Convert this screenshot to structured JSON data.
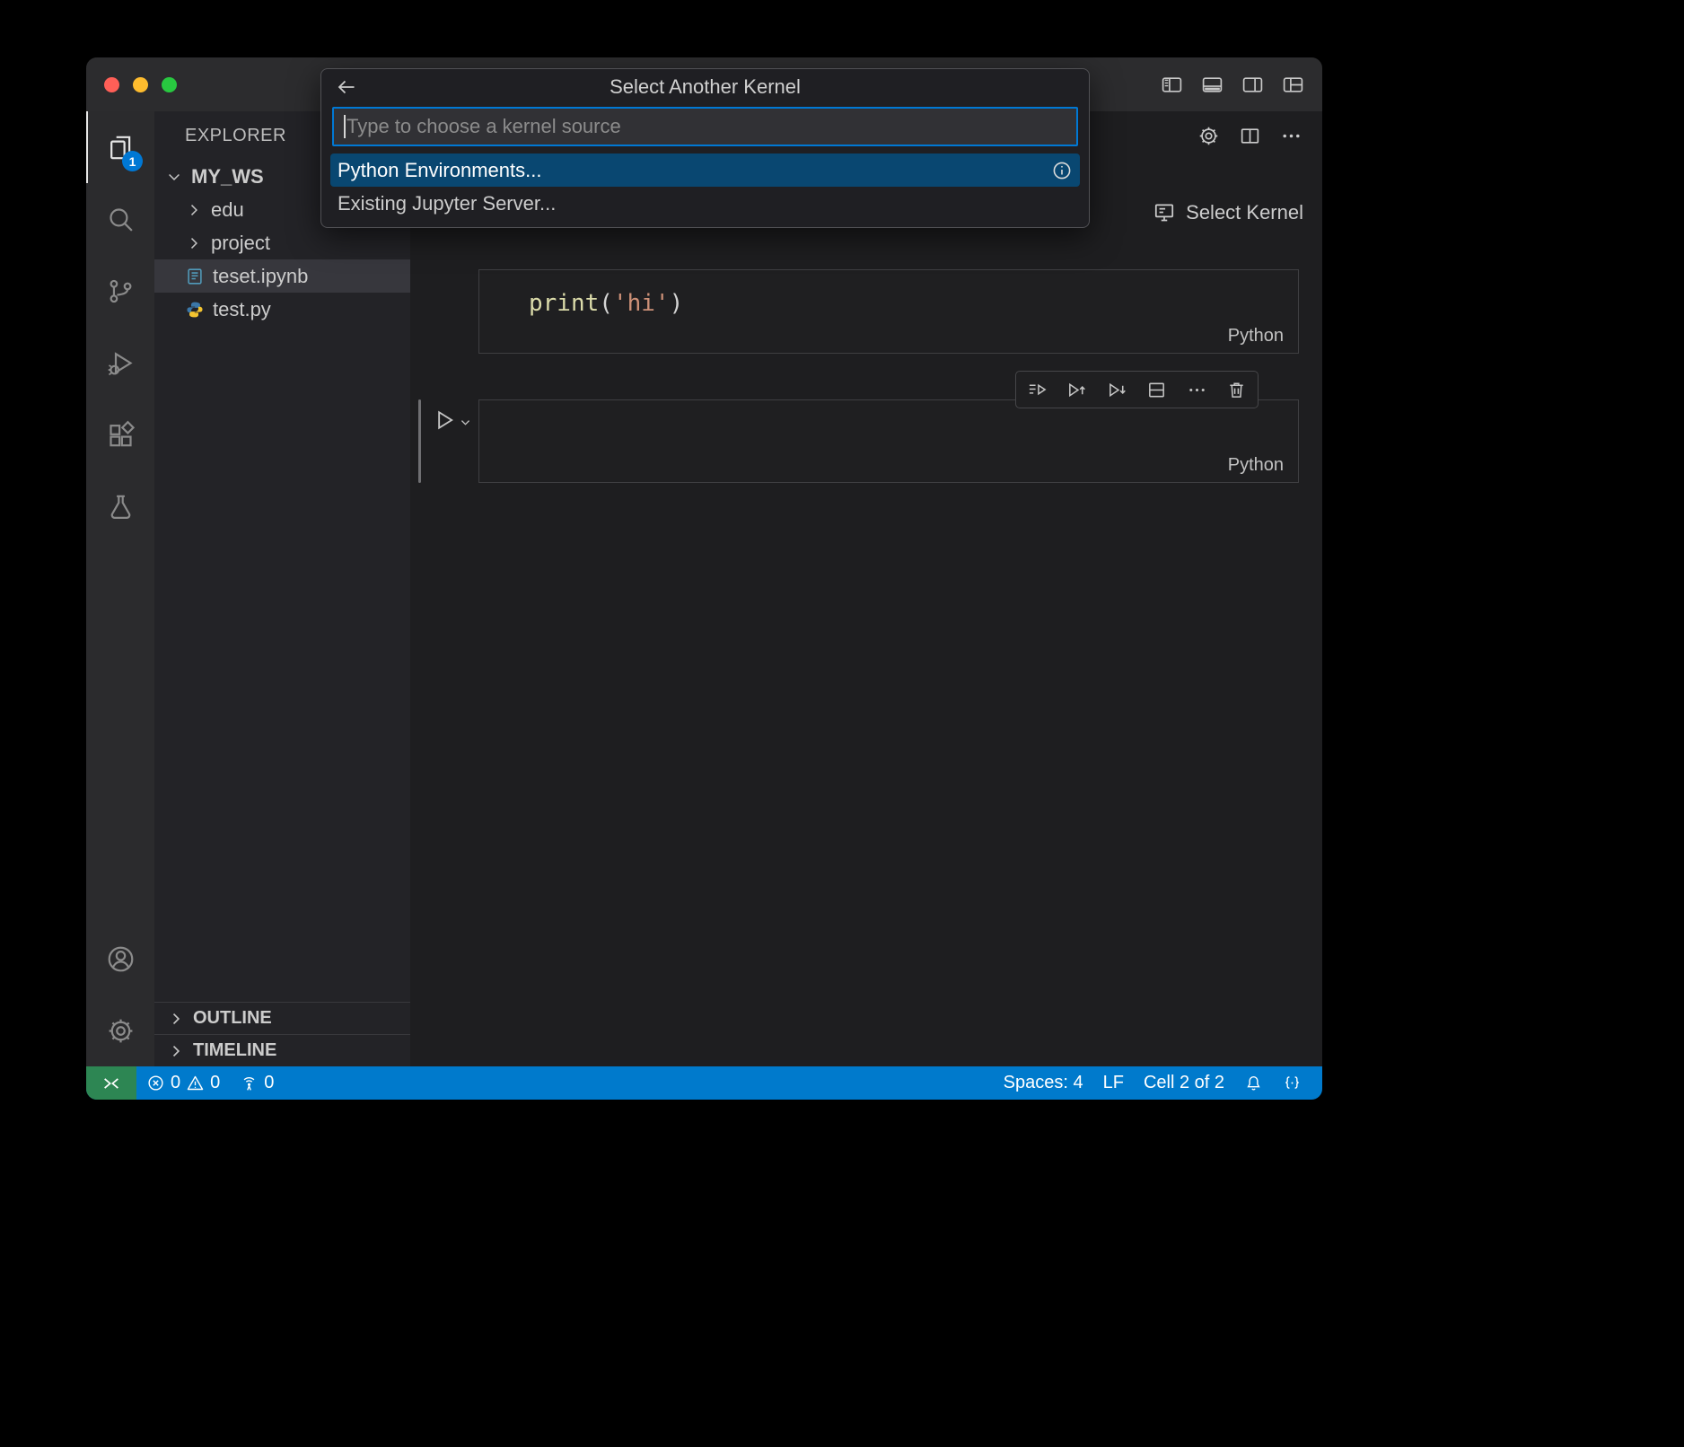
{
  "quick_pick": {
    "title": "Select Another Kernel",
    "input_placeholder": "Type to choose a kernel source",
    "items": [
      {
        "label": "Python Environments..."
      },
      {
        "label": "Existing Jupyter Server..."
      }
    ]
  },
  "activity_bar": {
    "explorer_badge": "1"
  },
  "sidebar": {
    "title": "EXPLORER",
    "workspace_label": "MY_WS",
    "items": [
      {
        "label": "edu"
      },
      {
        "label": "project"
      },
      {
        "label": "teset.ipynb"
      },
      {
        "label": "test.py"
      }
    ],
    "bottom_sections": [
      {
        "label": "OUTLINE"
      },
      {
        "label": "TIMELINE"
      }
    ]
  },
  "editor": {
    "select_kernel_label": "Select Kernel",
    "cells": [
      {
        "tokens": [
          {
            "text": "print"
          },
          {
            "text": "("
          },
          {
            "text": "'hi'"
          },
          {
            "text": ")"
          }
        ],
        "language": "Python"
      },
      {
        "language": "Python"
      }
    ]
  },
  "status_bar": {
    "errors": "0",
    "warnings": "0",
    "ports": "0",
    "spaces": "Spaces: 4",
    "eol": "LF",
    "cell_indicator": "Cell 2 of 2"
  },
  "colors": {
    "accent": "#007acc",
    "list_selection": "#094771",
    "badge": "#0078d4",
    "remote_indicator": "#2d8653"
  }
}
